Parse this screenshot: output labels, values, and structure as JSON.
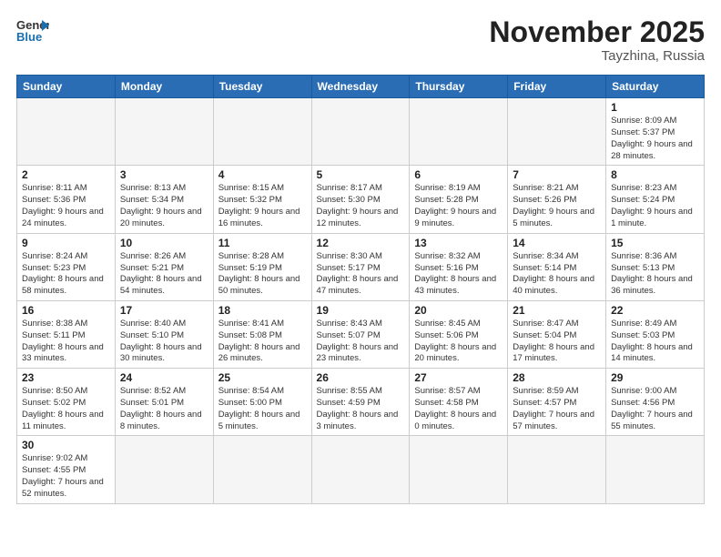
{
  "header": {
    "logo_general": "General",
    "logo_blue": "Blue",
    "month_title": "November 2025",
    "location": "Tayzhina, Russia"
  },
  "weekdays": [
    "Sunday",
    "Monday",
    "Tuesday",
    "Wednesday",
    "Thursday",
    "Friday",
    "Saturday"
  ],
  "weeks": [
    [
      {
        "day": "",
        "info": ""
      },
      {
        "day": "",
        "info": ""
      },
      {
        "day": "",
        "info": ""
      },
      {
        "day": "",
        "info": ""
      },
      {
        "day": "",
        "info": ""
      },
      {
        "day": "",
        "info": ""
      },
      {
        "day": "1",
        "info": "Sunrise: 8:09 AM\nSunset: 5:37 PM\nDaylight: 9 hours\nand 28 minutes."
      }
    ],
    [
      {
        "day": "2",
        "info": "Sunrise: 8:11 AM\nSunset: 5:36 PM\nDaylight: 9 hours\nand 24 minutes."
      },
      {
        "day": "3",
        "info": "Sunrise: 8:13 AM\nSunset: 5:34 PM\nDaylight: 9 hours\nand 20 minutes."
      },
      {
        "day": "4",
        "info": "Sunrise: 8:15 AM\nSunset: 5:32 PM\nDaylight: 9 hours\nand 16 minutes."
      },
      {
        "day": "5",
        "info": "Sunrise: 8:17 AM\nSunset: 5:30 PM\nDaylight: 9 hours\nand 12 minutes."
      },
      {
        "day": "6",
        "info": "Sunrise: 8:19 AM\nSunset: 5:28 PM\nDaylight: 9 hours\nand 9 minutes."
      },
      {
        "day": "7",
        "info": "Sunrise: 8:21 AM\nSunset: 5:26 PM\nDaylight: 9 hours\nand 5 minutes."
      },
      {
        "day": "8",
        "info": "Sunrise: 8:23 AM\nSunset: 5:24 PM\nDaylight: 9 hours\nand 1 minute."
      }
    ],
    [
      {
        "day": "9",
        "info": "Sunrise: 8:24 AM\nSunset: 5:23 PM\nDaylight: 8 hours\nand 58 minutes."
      },
      {
        "day": "10",
        "info": "Sunrise: 8:26 AM\nSunset: 5:21 PM\nDaylight: 8 hours\nand 54 minutes."
      },
      {
        "day": "11",
        "info": "Sunrise: 8:28 AM\nSunset: 5:19 PM\nDaylight: 8 hours\nand 50 minutes."
      },
      {
        "day": "12",
        "info": "Sunrise: 8:30 AM\nSunset: 5:17 PM\nDaylight: 8 hours\nand 47 minutes."
      },
      {
        "day": "13",
        "info": "Sunrise: 8:32 AM\nSunset: 5:16 PM\nDaylight: 8 hours\nand 43 minutes."
      },
      {
        "day": "14",
        "info": "Sunrise: 8:34 AM\nSunset: 5:14 PM\nDaylight: 8 hours\nand 40 minutes."
      },
      {
        "day": "15",
        "info": "Sunrise: 8:36 AM\nSunset: 5:13 PM\nDaylight: 8 hours\nand 36 minutes."
      }
    ],
    [
      {
        "day": "16",
        "info": "Sunrise: 8:38 AM\nSunset: 5:11 PM\nDaylight: 8 hours\nand 33 minutes."
      },
      {
        "day": "17",
        "info": "Sunrise: 8:40 AM\nSunset: 5:10 PM\nDaylight: 8 hours\nand 30 minutes."
      },
      {
        "day": "18",
        "info": "Sunrise: 8:41 AM\nSunset: 5:08 PM\nDaylight: 8 hours\nand 26 minutes."
      },
      {
        "day": "19",
        "info": "Sunrise: 8:43 AM\nSunset: 5:07 PM\nDaylight: 8 hours\nand 23 minutes."
      },
      {
        "day": "20",
        "info": "Sunrise: 8:45 AM\nSunset: 5:06 PM\nDaylight: 8 hours\nand 20 minutes."
      },
      {
        "day": "21",
        "info": "Sunrise: 8:47 AM\nSunset: 5:04 PM\nDaylight: 8 hours\nand 17 minutes."
      },
      {
        "day": "22",
        "info": "Sunrise: 8:49 AM\nSunset: 5:03 PM\nDaylight: 8 hours\nand 14 minutes."
      }
    ],
    [
      {
        "day": "23",
        "info": "Sunrise: 8:50 AM\nSunset: 5:02 PM\nDaylight: 8 hours\nand 11 minutes."
      },
      {
        "day": "24",
        "info": "Sunrise: 8:52 AM\nSunset: 5:01 PM\nDaylight: 8 hours\nand 8 minutes."
      },
      {
        "day": "25",
        "info": "Sunrise: 8:54 AM\nSunset: 5:00 PM\nDaylight: 8 hours\nand 5 minutes."
      },
      {
        "day": "26",
        "info": "Sunrise: 8:55 AM\nSunset: 4:59 PM\nDaylight: 8 hours\nand 3 minutes."
      },
      {
        "day": "27",
        "info": "Sunrise: 8:57 AM\nSunset: 4:58 PM\nDaylight: 8 hours\nand 0 minutes."
      },
      {
        "day": "28",
        "info": "Sunrise: 8:59 AM\nSunset: 4:57 PM\nDaylight: 7 hours\nand 57 minutes."
      },
      {
        "day": "29",
        "info": "Sunrise: 9:00 AM\nSunset: 4:56 PM\nDaylight: 7 hours\nand 55 minutes."
      }
    ],
    [
      {
        "day": "30",
        "info": "Sunrise: 9:02 AM\nSunset: 4:55 PM\nDaylight: 7 hours\nand 52 minutes."
      },
      {
        "day": "",
        "info": ""
      },
      {
        "day": "",
        "info": ""
      },
      {
        "day": "",
        "info": ""
      },
      {
        "day": "",
        "info": ""
      },
      {
        "day": "",
        "info": ""
      },
      {
        "day": "",
        "info": ""
      }
    ]
  ]
}
